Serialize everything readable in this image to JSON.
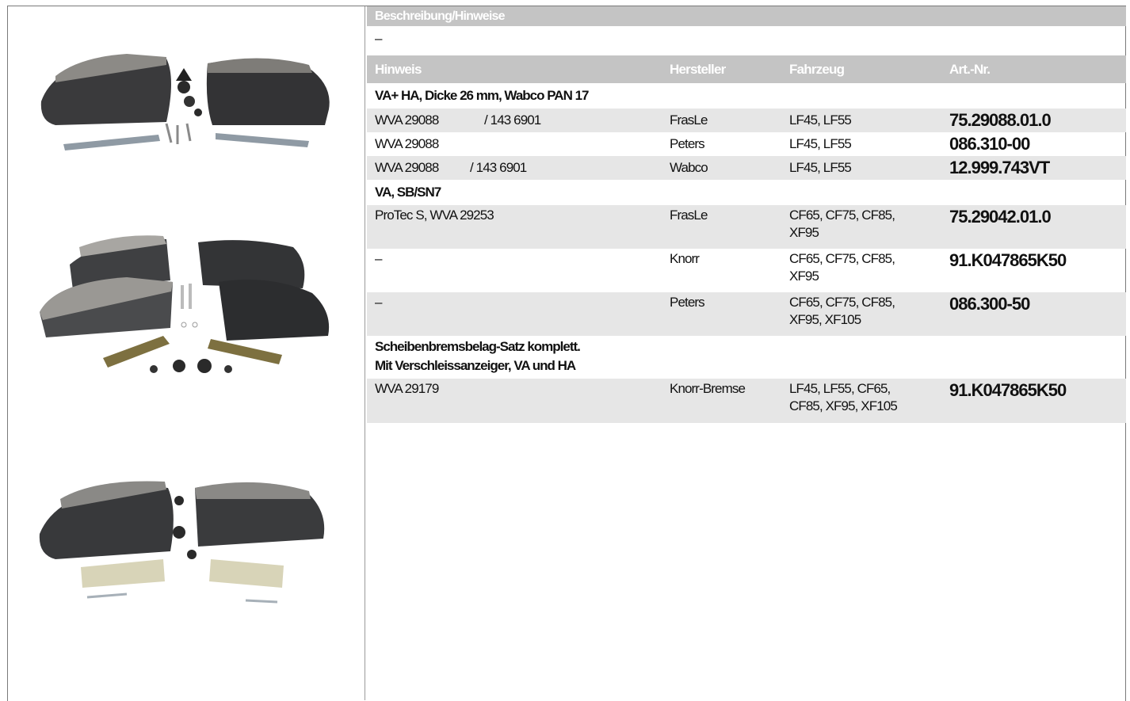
{
  "description_header": "Beschreibung/Hinweise",
  "description_value": "–",
  "columns": {
    "hint": "Hinweis",
    "manufacturer": "Hersteller",
    "vehicle": "Fahrzeug",
    "article": "Art.-Nr."
  },
  "groups": [
    {
      "title": "VA+ HA, Dicke 26 mm, Wabco PAN 17",
      "rows": [
        {
          "hint": "WVA 29088",
          "hint_extra": "/ 143 6901",
          "manufacturer": "FrasLe",
          "vehicle": "LF45, LF55",
          "article": "75.29088.01.0"
        },
        {
          "hint": "WVA 29088",
          "hint_extra": "",
          "manufacturer": "Peters",
          "vehicle": "LF45, LF55",
          "article": "086.310-00"
        },
        {
          "hint": "WVA 29088",
          "hint_extra": "/ 143 6901",
          "manufacturer": "Wabco",
          "vehicle": "LF45, LF55",
          "article": "12.999.743VT"
        }
      ]
    },
    {
      "title": "VA, SB/SN7",
      "rows": [
        {
          "hint": "ProTec S, WVA 29253",
          "hint_extra": "",
          "manufacturer": "FrasLe",
          "vehicle": "CF65, CF75, CF85,",
          "vehicle2": "XF95",
          "article": "75.29042.01.0"
        },
        {
          "hint": "–",
          "hint_extra": "",
          "manufacturer": "Knorr",
          "vehicle": "CF65, CF75, CF85,",
          "vehicle2": "XF95",
          "article": "91.K047865K50"
        },
        {
          "hint": "–",
          "hint_extra": "",
          "manufacturer": "Peters",
          "vehicle": "CF65, CF75, CF85,",
          "vehicle2": "XF95, XF105",
          "article": "086.300-50"
        }
      ]
    },
    {
      "title": "Scheibenbremsbelag-Satz komplett.",
      "title2": "Mit Verschleissanzeiger, VA und HA",
      "rows": [
        {
          "hint": "WVA 29179",
          "hint_extra": "",
          "manufacturer": "Knorr-Bremse",
          "vehicle": "LF45, LF55, CF65,",
          "vehicle2": "CF85, XF95, XF105",
          "article": "91.K047865K50"
        }
      ]
    }
  ],
  "images": [
    "brake-pad-set-photo",
    "brake-pad-set-photo",
    "brake-pad-set-photo"
  ]
}
